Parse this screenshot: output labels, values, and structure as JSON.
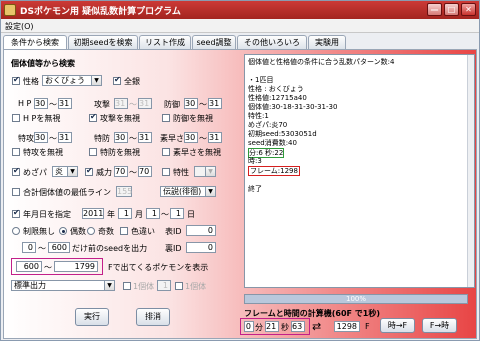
{
  "window": {
    "title": "DSポケモン用 疑似乱数計算プログラム",
    "minimize": "—",
    "maximize": "□",
    "close": "✕"
  },
  "menu": {
    "settings": "設定(O)"
  },
  "tabs": [
    "条件から検索",
    "初期seedを検索",
    "リスト作成",
    "seed調整",
    "その他いろいろ",
    "実験用"
  ],
  "left": {
    "heading": "個体値等から検索",
    "nature_label": "性格",
    "nature_value": "おくびょう",
    "all_silver_label": "全銀",
    "hp_label": "H P",
    "hp_min": "30",
    "hp_sep": "～",
    "hp_max": "31",
    "atk_label": "攻撃",
    "atk_min": "31",
    "atk_max": "31",
    "def_label": "防御",
    "def_min": "30",
    "def_max": "31",
    "hp_ignore": "H Pを無視",
    "atk_ignore": "攻撃を無視",
    "def_ignore": "防御を無視",
    "spa_label": "特攻",
    "spa_min": "30",
    "spa_max": "31",
    "spd_label": "特防",
    "spd_min": "30",
    "spd_max": "31",
    "spe_label": "素早さ",
    "spe_min": "30",
    "spe_max": "31",
    "spa_ignore": "特攻を無視",
    "spd_ignore": "特防を無視",
    "spe_ignore": "素早さを無視",
    "hp_type_label": "めざパ",
    "hp_type_value": "炎",
    "power_label": "威力",
    "power_min": "70",
    "power_max": "70",
    "trait_label": "特性",
    "iv_total_label": "合計個体値の最低ライン",
    "iv_total_value": "155",
    "legend_value": "伝説(徘徊)",
    "date_label": "年月日を指定",
    "year_value": "2011",
    "year_unit": "年",
    "month_value": "1",
    "month_unit": "月",
    "day_from": "1",
    "day_to": "1",
    "day_unit": "日",
    "no_limit_label": "制限無し",
    "even_label": "偶数",
    "odd_label": "奇数",
    "shiny_label": "色違い",
    "table_id_label": "表ID",
    "table_id_value": "0",
    "seed_from": "0",
    "seed_to": "600",
    "seed_desc": "だけ前のseedを出力",
    "hidden_id_label": "裏ID",
    "hidden_id_value": "0",
    "frame_from": "600",
    "frame_to": "1799",
    "frame_desc": "Fで出てくるポケモンを表示",
    "output_mode": "標準出力",
    "chain_label": "1個体",
    "chain_value": "1",
    "execute_button": "実行",
    "cancel_button": "排消"
  },
  "results": {
    "lines": [
      "個体値と性格値の条件に合う乱数パターン数:4",
      "",
      "・1匹目",
      "性格 : おくびょう",
      "性格値:12715a40",
      "個体値:30-18-31-30-31-30",
      "特性:1",
      "めざパ:炎70",
      "初期seed:5303051d",
      "seed消費数:40",
      "分:6 秒:22",
      "時:3",
      "フレーム:1298",
      "",
      "終了"
    ]
  },
  "progress": {
    "percent": 1.0,
    "label": "100%"
  },
  "frame_time": {
    "heading": "フレームと時間の計算機(60F で1秒)",
    "hours": "0",
    "min_unit": "分",
    "minutes": "21",
    "sec_unit": "秒",
    "seconds": "63",
    "arrow": "⇄",
    "frames": "1298",
    "frame_unit": "F",
    "to_frames_button": "時→F",
    "to_time_button": "F→時"
  }
}
